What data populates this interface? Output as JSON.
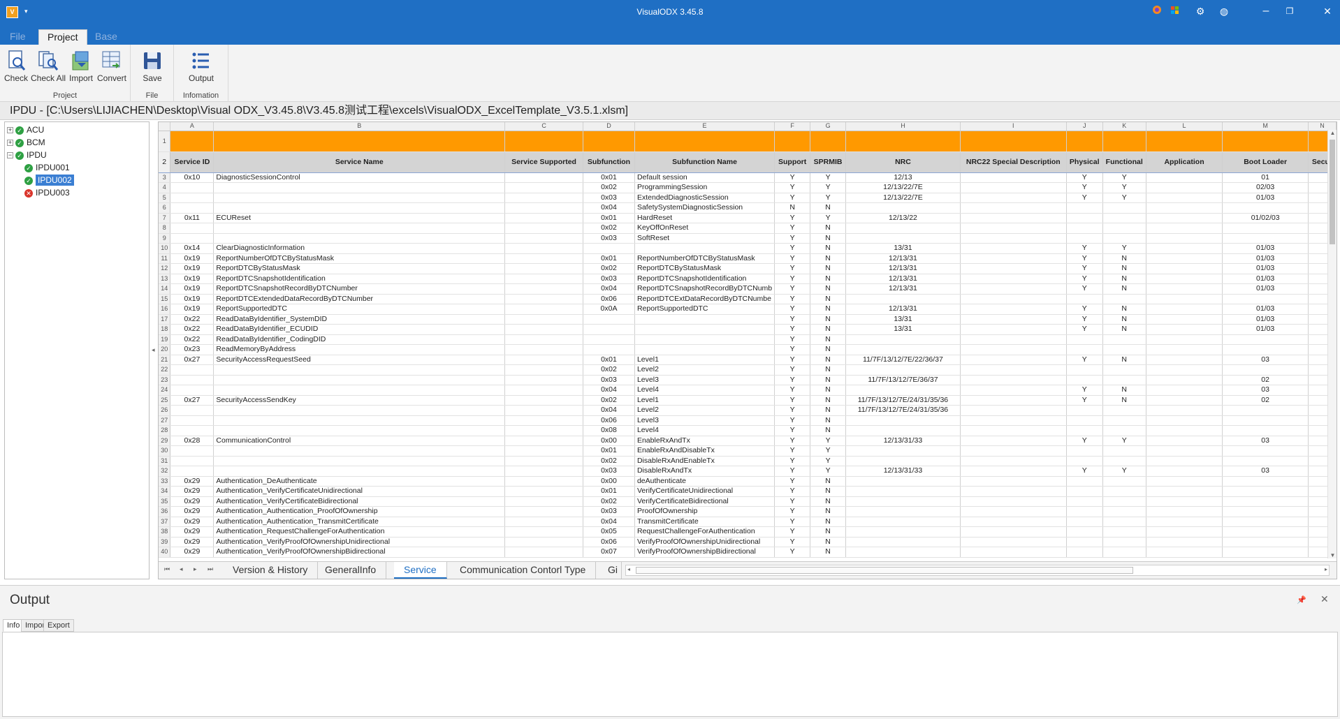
{
  "window": {
    "title": "VisualODX 3.45.8",
    "app_icon": "V",
    "controls": [
      "restore",
      "maximize",
      "close"
    ]
  },
  "ribbon": {
    "tabs": [
      {
        "label": "File"
      },
      {
        "label": "Project",
        "active": true
      },
      {
        "label": "Base"
      }
    ],
    "groups": [
      {
        "label": "Project",
        "buttons": [
          {
            "label": "Check",
            "icon": "check-doc-icon"
          },
          {
            "label": "Check All",
            "icon": "check-all-icon"
          },
          {
            "label": "Import",
            "icon": "import-icon"
          },
          {
            "label": "Convert",
            "icon": "convert-icon"
          }
        ]
      },
      {
        "label": "File",
        "buttons": [
          {
            "label": "Save",
            "icon": "save-icon"
          }
        ]
      },
      {
        "label": "Infomation",
        "buttons": [
          {
            "label": "Output",
            "icon": "list-icon"
          }
        ]
      }
    ]
  },
  "path": "IPDU - [C:\\Users\\LIJIACHEN\\Desktop\\Visual ODX_V3.45.8\\V3.45.8测试工程\\excels\\VisualODX_ExcelTemplate_V3.5.1.xlsm]",
  "tree": [
    {
      "label": "ACU",
      "status": "ok",
      "expander": "+",
      "level": 0
    },
    {
      "label": "BCM",
      "status": "ok",
      "expander": "+",
      "level": 0
    },
    {
      "label": "IPDU",
      "status": "ok",
      "expander": "−",
      "level": 0
    },
    {
      "label": "IPDU001",
      "status": "ok",
      "level": 1
    },
    {
      "label": "IPDU002",
      "status": "ok",
      "level": 1,
      "selected": true
    },
    {
      "label": "IPDU003",
      "status": "error",
      "level": 1
    }
  ],
  "sheet": {
    "column_letters": [
      "A",
      "B",
      "C",
      "D",
      "E",
      "F",
      "G",
      "H",
      "I",
      "J",
      "K",
      "L",
      "M",
      "N"
    ],
    "headers": [
      "Service ID",
      "Service Name",
      "Service Supported",
      "Subfunction",
      "Subfunction Name",
      "Support",
      "SPRMIB",
      "NRC",
      "NRC22 Special Description",
      "Physical",
      "Functional",
      "Application",
      "Boot Loader",
      "Secur"
    ],
    "rows": [
      [
        "0x10",
        "DiagnosticSessionControl",
        "",
        "0x01",
        "Default session",
        "Y",
        "Y",
        "12/13",
        "",
        "Y",
        "Y",
        "",
        "01",
        ""
      ],
      [
        "",
        "",
        "",
        "0x02",
        "ProgrammingSession",
        "Y",
        "Y",
        "12/13/22/7E",
        "",
        "Y",
        "Y",
        "",
        "02/03",
        ""
      ],
      [
        "",
        "",
        "",
        "0x03",
        "ExtendedDiagnosticSession",
        "Y",
        "Y",
        "12/13/22/7E",
        "",
        "Y",
        "Y",
        "",
        "01/03",
        ""
      ],
      [
        "",
        "",
        "",
        "0x04",
        "SafetySystemDiagnosticSession",
        "N",
        "N",
        "",
        "",
        "",
        "",
        "",
        "",
        ""
      ],
      [
        "0x11",
        "ECUReset",
        "",
        "0x01",
        "HardReset",
        "Y",
        "Y",
        "12/13/22",
        "",
        "",
        "",
        "",
        "01/02/03",
        ""
      ],
      [
        "",
        "",
        "",
        "0x02",
        "KeyOffOnReset",
        "Y",
        "N",
        "",
        "",
        "",
        "",
        "",
        "",
        ""
      ],
      [
        "",
        "",
        "",
        "0x03",
        "SoftReset",
        "Y",
        "N",
        "",
        "",
        "",
        "",
        "",
        "",
        ""
      ],
      [
        "0x14",
        "ClearDiagnosticInformation",
        "",
        "",
        "",
        "Y",
        "N",
        "13/31",
        "",
        "Y",
        "Y",
        "",
        "01/03",
        ""
      ],
      [
        "0x19",
        "ReportNumberOfDTCByStatusMask",
        "",
        "0x01",
        "ReportNumberOfDTCByStatusMask",
        "Y",
        "N",
        "12/13/31",
        "",
        "Y",
        "N",
        "",
        "01/03",
        ""
      ],
      [
        "0x19",
        "ReportDTCByStatusMask",
        "",
        "0x02",
        "ReportDTCByStatusMask",
        "Y",
        "N",
        "12/13/31",
        "",
        "Y",
        "N",
        "",
        "01/03",
        ""
      ],
      [
        "0x19",
        "ReportDTCSnapshotIdentification",
        "",
        "0x03",
        "ReportDTCSnapshotIdentification",
        "Y",
        "N",
        "12/13/31",
        "",
        "Y",
        "N",
        "",
        "01/03",
        ""
      ],
      [
        "0x19",
        "ReportDTCSnapshotRecordByDTCNumber",
        "",
        "0x04",
        "ReportDTCSnapshotRecordByDTCNumb",
        "Y",
        "N",
        "12/13/31",
        "",
        "Y",
        "N",
        "",
        "01/03",
        ""
      ],
      [
        "0x19",
        "ReportDTCExtendedDataRecordByDTCNumber",
        "",
        "0x06",
        "ReportDTCExtDataRecordByDTCNumbe",
        "Y",
        "N",
        "",
        "",
        "",
        "",
        "",
        "",
        ""
      ],
      [
        "0x19",
        "ReportSupportedDTC",
        "",
        "0x0A",
        "ReportSupportedDTC",
        "Y",
        "N",
        "12/13/31",
        "",
        "Y",
        "N",
        "",
        "01/03",
        ""
      ],
      [
        "0x22",
        "ReadDataByIdentifier_SystemDID",
        "",
        "",
        "",
        "Y",
        "N",
        "13/31",
        "",
        "Y",
        "N",
        "",
        "01/03",
        ""
      ],
      [
        "0x22",
        "ReadDataByIdentifier_ECUDID",
        "",
        "",
        "",
        "Y",
        "N",
        "13/31",
        "",
        "Y",
        "N",
        "",
        "01/03",
        ""
      ],
      [
        "0x22",
        "ReadDataByIdentifier_CodingDID",
        "",
        "",
        "",
        "Y",
        "N",
        "",
        "",
        "",
        "",
        "",
        "",
        ""
      ],
      [
        "0x23",
        "ReadMemoryByAddress",
        "",
        "",
        "",
        "Y",
        "N",
        "",
        "",
        "",
        "",
        "",
        "",
        ""
      ],
      [
        "0x27",
        "SecurityAccessRequestSeed",
        "",
        "0x01",
        "Level1",
        "Y",
        "N",
        "11/7F/13/12/7E/22/36/37",
        "",
        "Y",
        "N",
        "",
        "03",
        ""
      ],
      [
        "",
        "",
        "",
        "0x02",
        "Level2",
        "Y",
        "N",
        "",
        "",
        "",
        "",
        "",
        "",
        ""
      ],
      [
        "",
        "",
        "",
        "0x03",
        "Level3",
        "Y",
        "N",
        "11/7F/13/12/7E/36/37",
        "",
        "",
        "",
        "",
        "02",
        ""
      ],
      [
        "",
        "",
        "",
        "0x04",
        "Level4",
        "Y",
        "N",
        "",
        "",
        "Y",
        "N",
        "",
        "03",
        ""
      ],
      [
        "0x27",
        "SecurityAccessSendKey",
        "",
        "0x02",
        "Level1",
        "Y",
        "N",
        "11/7F/13/12/7E/24/31/35/36",
        "",
        "Y",
        "N",
        "",
        "02",
        ""
      ],
      [
        "",
        "",
        "",
        "0x04",
        "Level2",
        "Y",
        "N",
        "11/7F/13/12/7E/24/31/35/36",
        "",
        "",
        "",
        "",
        "",
        ""
      ],
      [
        "",
        "",
        "",
        "0x06",
        "Level3",
        "Y",
        "N",
        "",
        "",
        "",
        "",
        "",
        "",
        ""
      ],
      [
        "",
        "",
        "",
        "0x08",
        "Level4",
        "Y",
        "N",
        "",
        "",
        "",
        "",
        "",
        "",
        ""
      ],
      [
        "0x28",
        "CommunicationControl",
        "",
        "0x00",
        "EnableRxAndTx",
        "Y",
        "Y",
        "12/13/31/33",
        "",
        "Y",
        "Y",
        "",
        "03",
        ""
      ],
      [
        "",
        "",
        "",
        "0x01",
        "EnableRxAndDisableTx",
        "Y",
        "Y",
        "",
        "",
        "",
        "",
        "",
        "",
        ""
      ],
      [
        "",
        "",
        "",
        "0x02",
        "DisableRxAndEnableTx",
        "Y",
        "Y",
        "",
        "",
        "",
        "",
        "",
        "",
        ""
      ],
      [
        "",
        "",
        "",
        "0x03",
        "DisableRxAndTx",
        "Y",
        "Y",
        "12/13/31/33",
        "",
        "Y",
        "Y",
        "",
        "03",
        ""
      ],
      [
        "0x29",
        "Authentication_DeAuthenticate",
        "",
        "0x00",
        "deAuthenticate",
        "Y",
        "N",
        "",
        "",
        "",
        "",
        "",
        "",
        ""
      ],
      [
        "0x29",
        "Authentication_VerifyCertificateUnidirectional",
        "",
        "0x01",
        "VerifyCertificateUnidirectional",
        "Y",
        "N",
        "",
        "",
        "",
        "",
        "",
        "",
        ""
      ],
      [
        "0x29",
        "Authentication_VerifyCertificateBidirectional",
        "",
        "0x02",
        "VerifyCertificateBidirectional",
        "Y",
        "N",
        "",
        "",
        "",
        "",
        "",
        "",
        ""
      ],
      [
        "0x29",
        "Authentication_Authentication_ProofOfOwnership",
        "",
        "0x03",
        "ProofOfOwnership",
        "Y",
        "N",
        "",
        "",
        "",
        "",
        "",
        "",
        ""
      ],
      [
        "0x29",
        "Authentication_Authentication_TransmitCertificate",
        "",
        "0x04",
        "TransmitCertificate",
        "Y",
        "N",
        "",
        "",
        "",
        "",
        "",
        "",
        ""
      ],
      [
        "0x29",
        "Authentication_RequestChallengeForAuthentication",
        "",
        "0x05",
        "RequestChallengeForAuthentication",
        "Y",
        "N",
        "",
        "",
        "",
        "",
        "",
        "",
        ""
      ],
      [
        "0x29",
        "Authentication_VerifyProofOfOwnershipUnidirectional",
        "",
        "0x06",
        "VerifyProofOfOwnershipUnidirectional",
        "Y",
        "N",
        "",
        "",
        "",
        "",
        "",
        "",
        ""
      ],
      [
        "0x29",
        "Authentication_VerifyProofOfOwnershipBidirectional",
        "",
        "0x07",
        "VerifyProofOfOwnershipBidirectional",
        "Y",
        "N",
        "",
        "",
        "",
        "",
        "",
        "",
        ""
      ]
    ],
    "tabs": [
      {
        "label": "Version & History"
      },
      {
        "label": "GeneralInfo"
      },
      {
        "label": "Service",
        "active": true
      },
      {
        "label": "Communication Contorl Type"
      },
      {
        "label": "Gi"
      }
    ]
  },
  "output": {
    "title": "Output",
    "tabs": [
      {
        "label": "Info",
        "active": true
      },
      {
        "label": "Import"
      },
      {
        "label": "Export"
      }
    ]
  },
  "colors": {
    "titlebar": "#1f6fc4",
    "header_orange": "#ff9900",
    "header_gray": "#d4d4d4",
    "ok_green": "#2ea043",
    "error_red": "#d9342b"
  }
}
